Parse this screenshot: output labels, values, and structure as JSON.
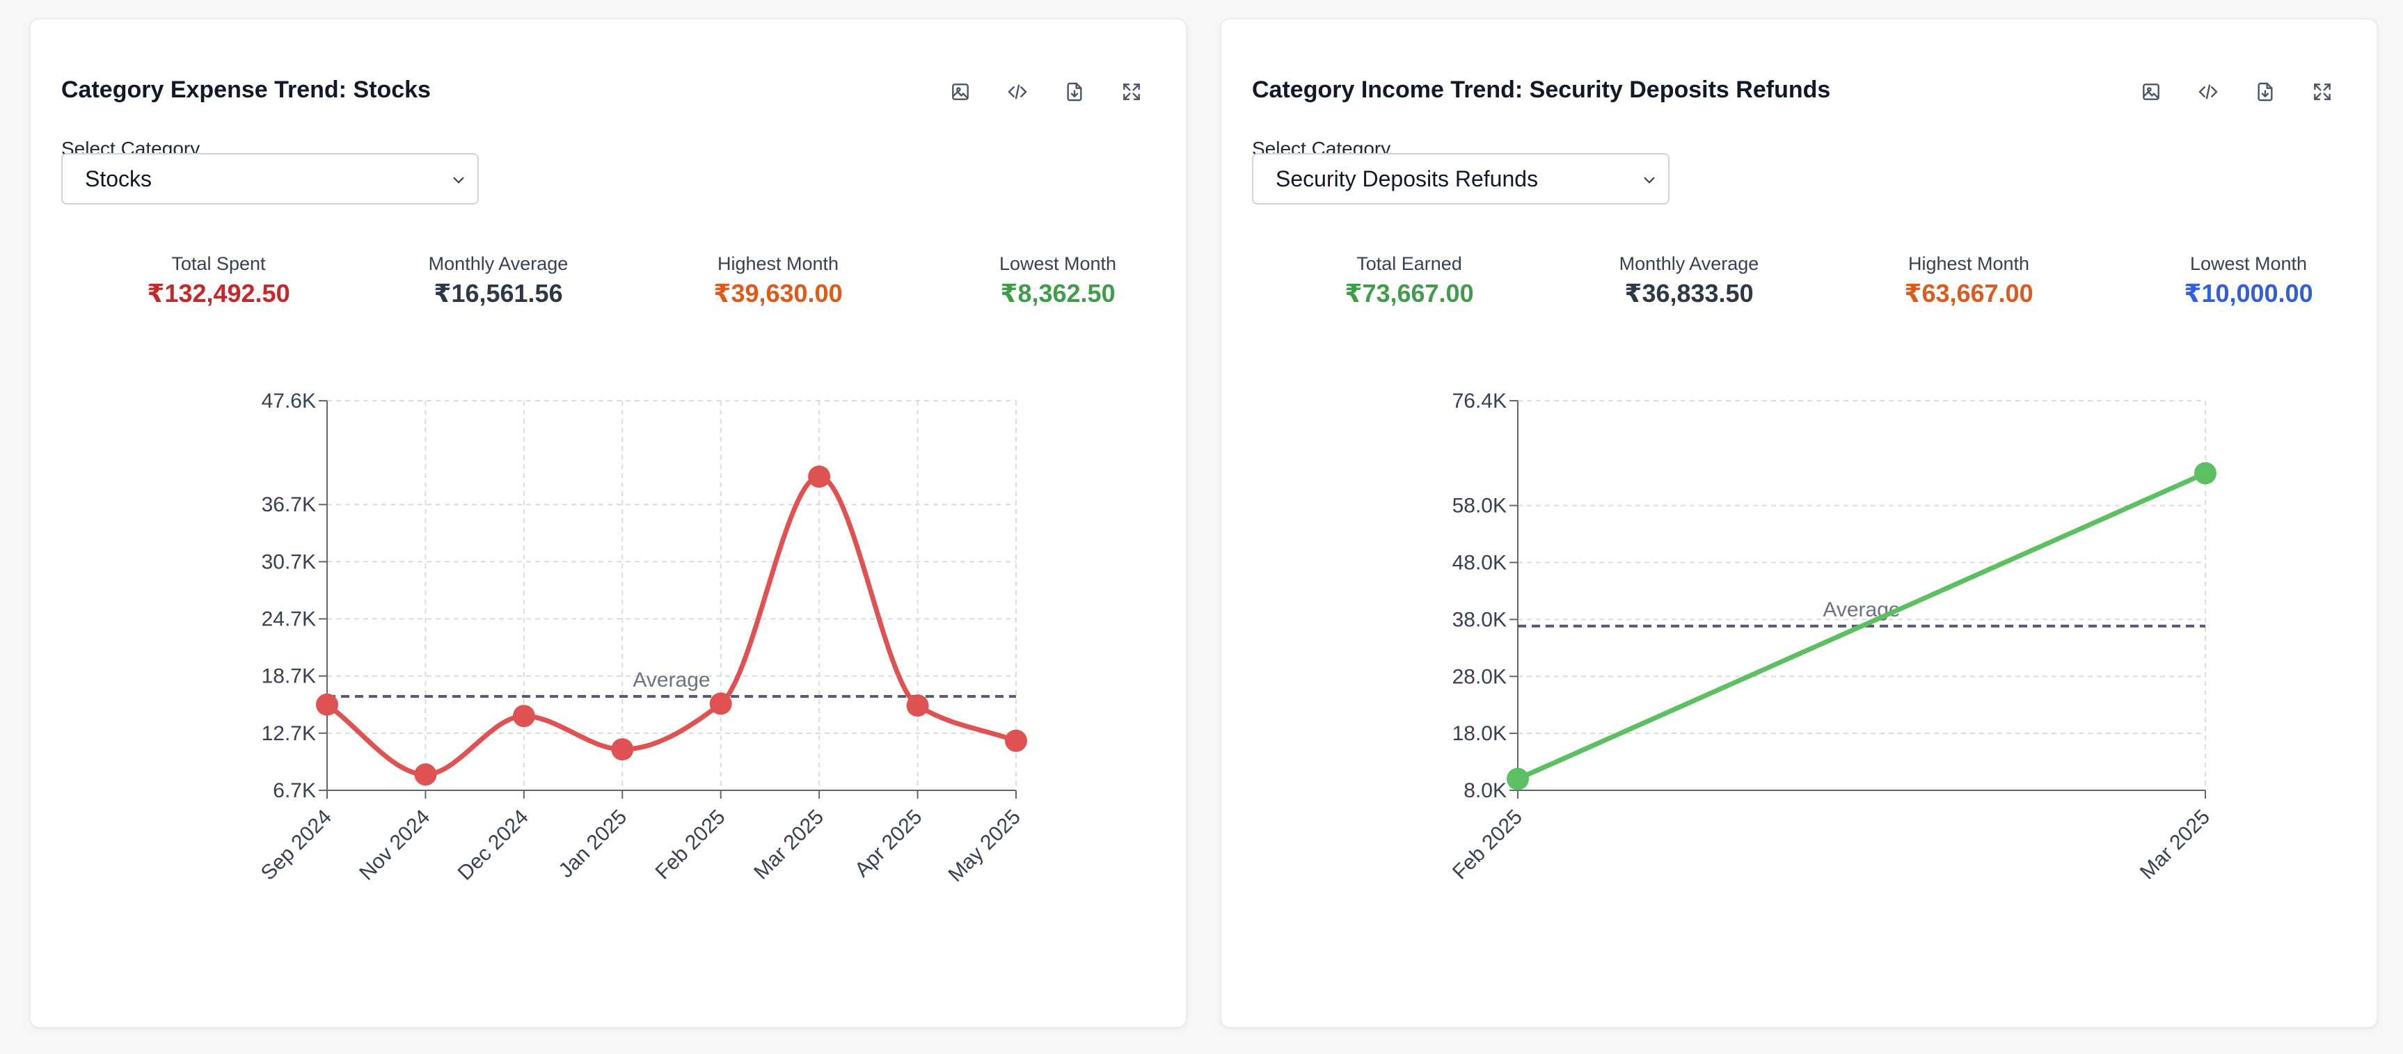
{
  "left_card": {
    "title": "Category Expense Trend: Stocks",
    "select_label": "Select Category",
    "select_value": "Stocks",
    "stats": [
      {
        "label": "Total Spent",
        "value": "₹132,492.50",
        "color": "#c62828"
      },
      {
        "label": "Monthly Average",
        "value": "₹16,561.56",
        "color": "#2d3748"
      },
      {
        "label": "Highest Month",
        "value": "₹39,630.00",
        "color": "#dd5a1b"
      },
      {
        "label": "Lowest Month",
        "value": "₹8,362.50",
        "color": "#3f9d4a"
      }
    ],
    "average_label": "Average",
    "icons": [
      "image-icon",
      "code-icon",
      "download-icon",
      "fullscreen-icon"
    ]
  },
  "right_card": {
    "title": "Category Income Trend: Security Deposits Refunds",
    "select_label": "Select Category",
    "select_value": "Security Deposits Refunds",
    "stats": [
      {
        "label": "Total Earned",
        "value": "₹73,667.00",
        "color": "#3f9d4a"
      },
      {
        "label": "Monthly Average",
        "value": "₹36,833.50",
        "color": "#2d3748"
      },
      {
        "label": "Highest Month",
        "value": "₹63,667.00",
        "color": "#dd5a1b"
      },
      {
        "label": "Lowest Month",
        "value": "₹10,000.00",
        "color": "#2f5fe0"
      }
    ],
    "average_label": "Average",
    "icons": [
      "image-icon",
      "code-icon",
      "download-icon",
      "fullscreen-icon"
    ]
  },
  "chart_data": [
    {
      "type": "line",
      "x": [
        "Sep 2024",
        "Nov 2024",
        "Dec 2024",
        "Jan 2025",
        "Feb 2025",
        "Mar 2025",
        "Apr 2025",
        "May 2025"
      ],
      "series": [
        {
          "values": [
            15700,
            8362.5,
            14500,
            11000,
            15800,
            39630,
            15600,
            11900
          ],
          "color": "#e05252"
        }
      ],
      "average": 16561.56,
      "yticks": [
        "6.7K",
        "12.7K",
        "18.7K",
        "24.7K",
        "30.7K",
        "36.7K",
        "47.6K"
      ],
      "ytick_values": [
        6700,
        12700,
        18700,
        24700,
        30700,
        36700,
        47600
      ],
      "ylim": [
        6700,
        47600
      ],
      "curve": "smooth",
      "grid": true
    },
    {
      "type": "line",
      "x": [
        "Feb 2025",
        "Mar 2025"
      ],
      "series": [
        {
          "values": [
            10000,
            63667
          ],
          "color": "#5cc063"
        }
      ],
      "average": 36833.5,
      "yticks": [
        "8.0K",
        "18.0K",
        "28.0K",
        "38.0K",
        "48.0K",
        "58.0K",
        "76.4K"
      ],
      "ytick_values": [
        8000,
        18000,
        28000,
        38000,
        48000,
        58000,
        76400
      ],
      "ylim": [
        8000,
        76400
      ],
      "curve": "linear",
      "grid": true
    }
  ]
}
